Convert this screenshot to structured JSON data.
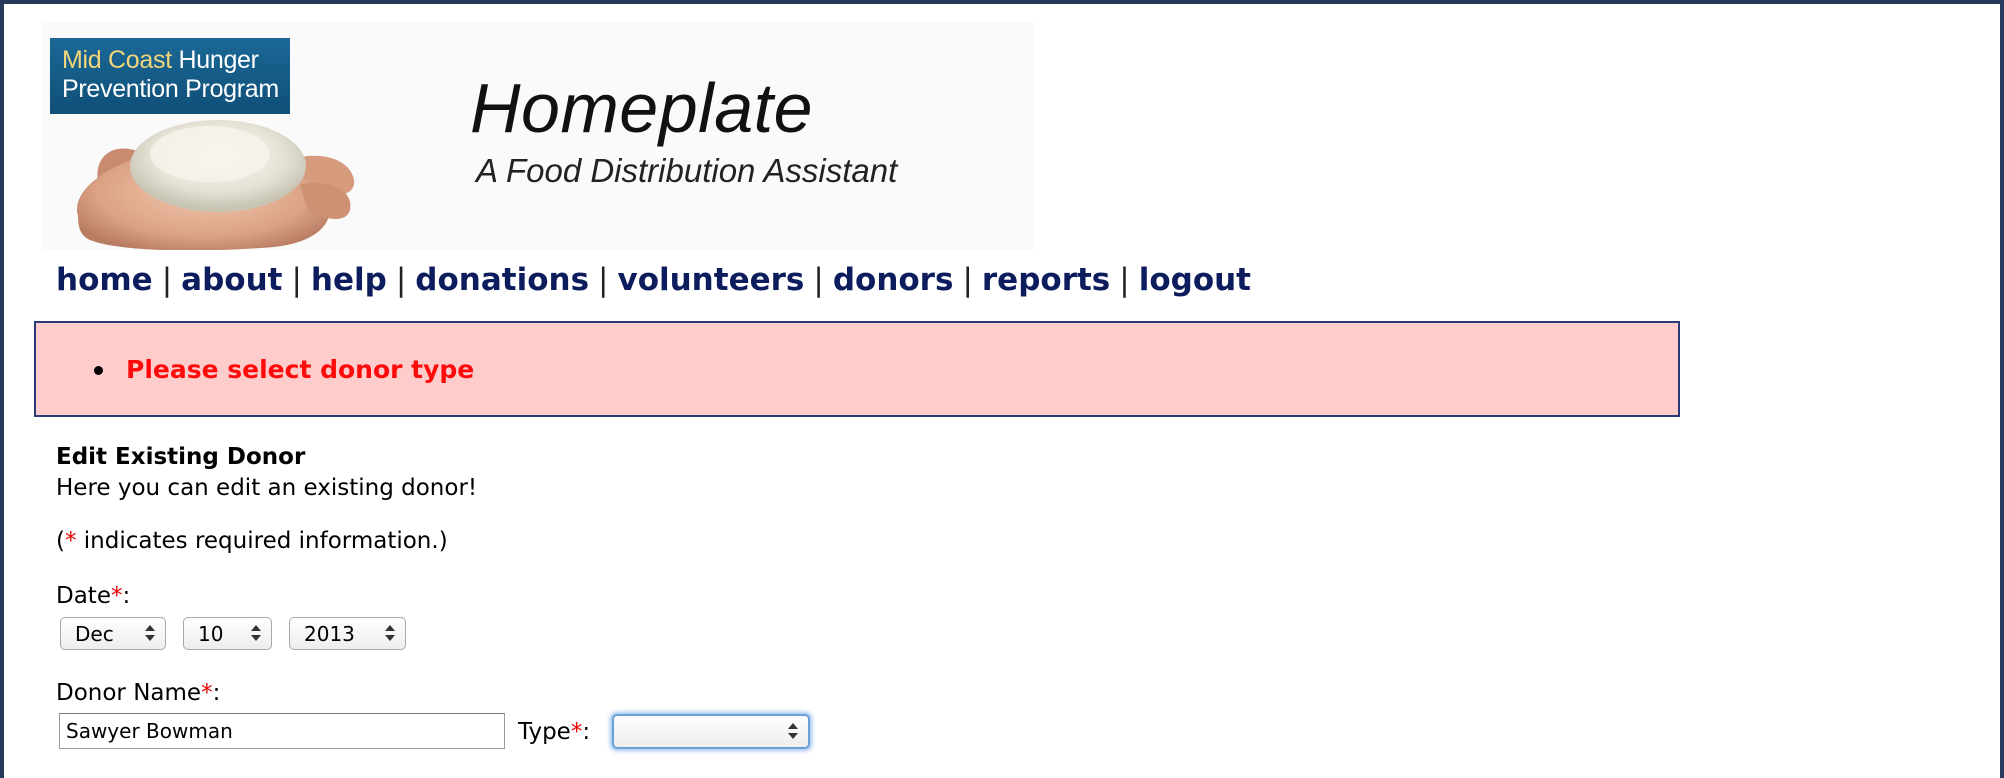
{
  "header": {
    "logo_line1_accent": "Mid Coast",
    "logo_line1_rest": " Hunger",
    "logo_line2": "Prevention Program",
    "title": "Homeplate",
    "subtitle": "A Food Distribution Assistant"
  },
  "nav": {
    "items": [
      "home",
      "about",
      "help",
      "donations",
      "volunteers",
      "donors",
      "reports",
      "logout"
    ],
    "separator": "|"
  },
  "error": {
    "messages": [
      "Please select donor type"
    ],
    "background_color": "#ffcccc",
    "text_color": "#ff0a0a"
  },
  "form": {
    "heading": "Edit Existing Donor",
    "intro": "Here you can edit an existing donor!",
    "required_note_prefix": "(",
    "required_marker": "*",
    "required_note_suffix": " indicates required information.)",
    "date_label": "Date",
    "date_month": "Dec",
    "date_day": "10",
    "date_year": "2013",
    "donor_name_label": "Donor Name",
    "donor_name_value": "Sawyer Bowman",
    "type_label": "Type",
    "type_value": "",
    "label_colon": ":"
  },
  "colors": {
    "frame": "#283a5c",
    "nav": "#0c1c5c",
    "required": "#ee0000"
  }
}
